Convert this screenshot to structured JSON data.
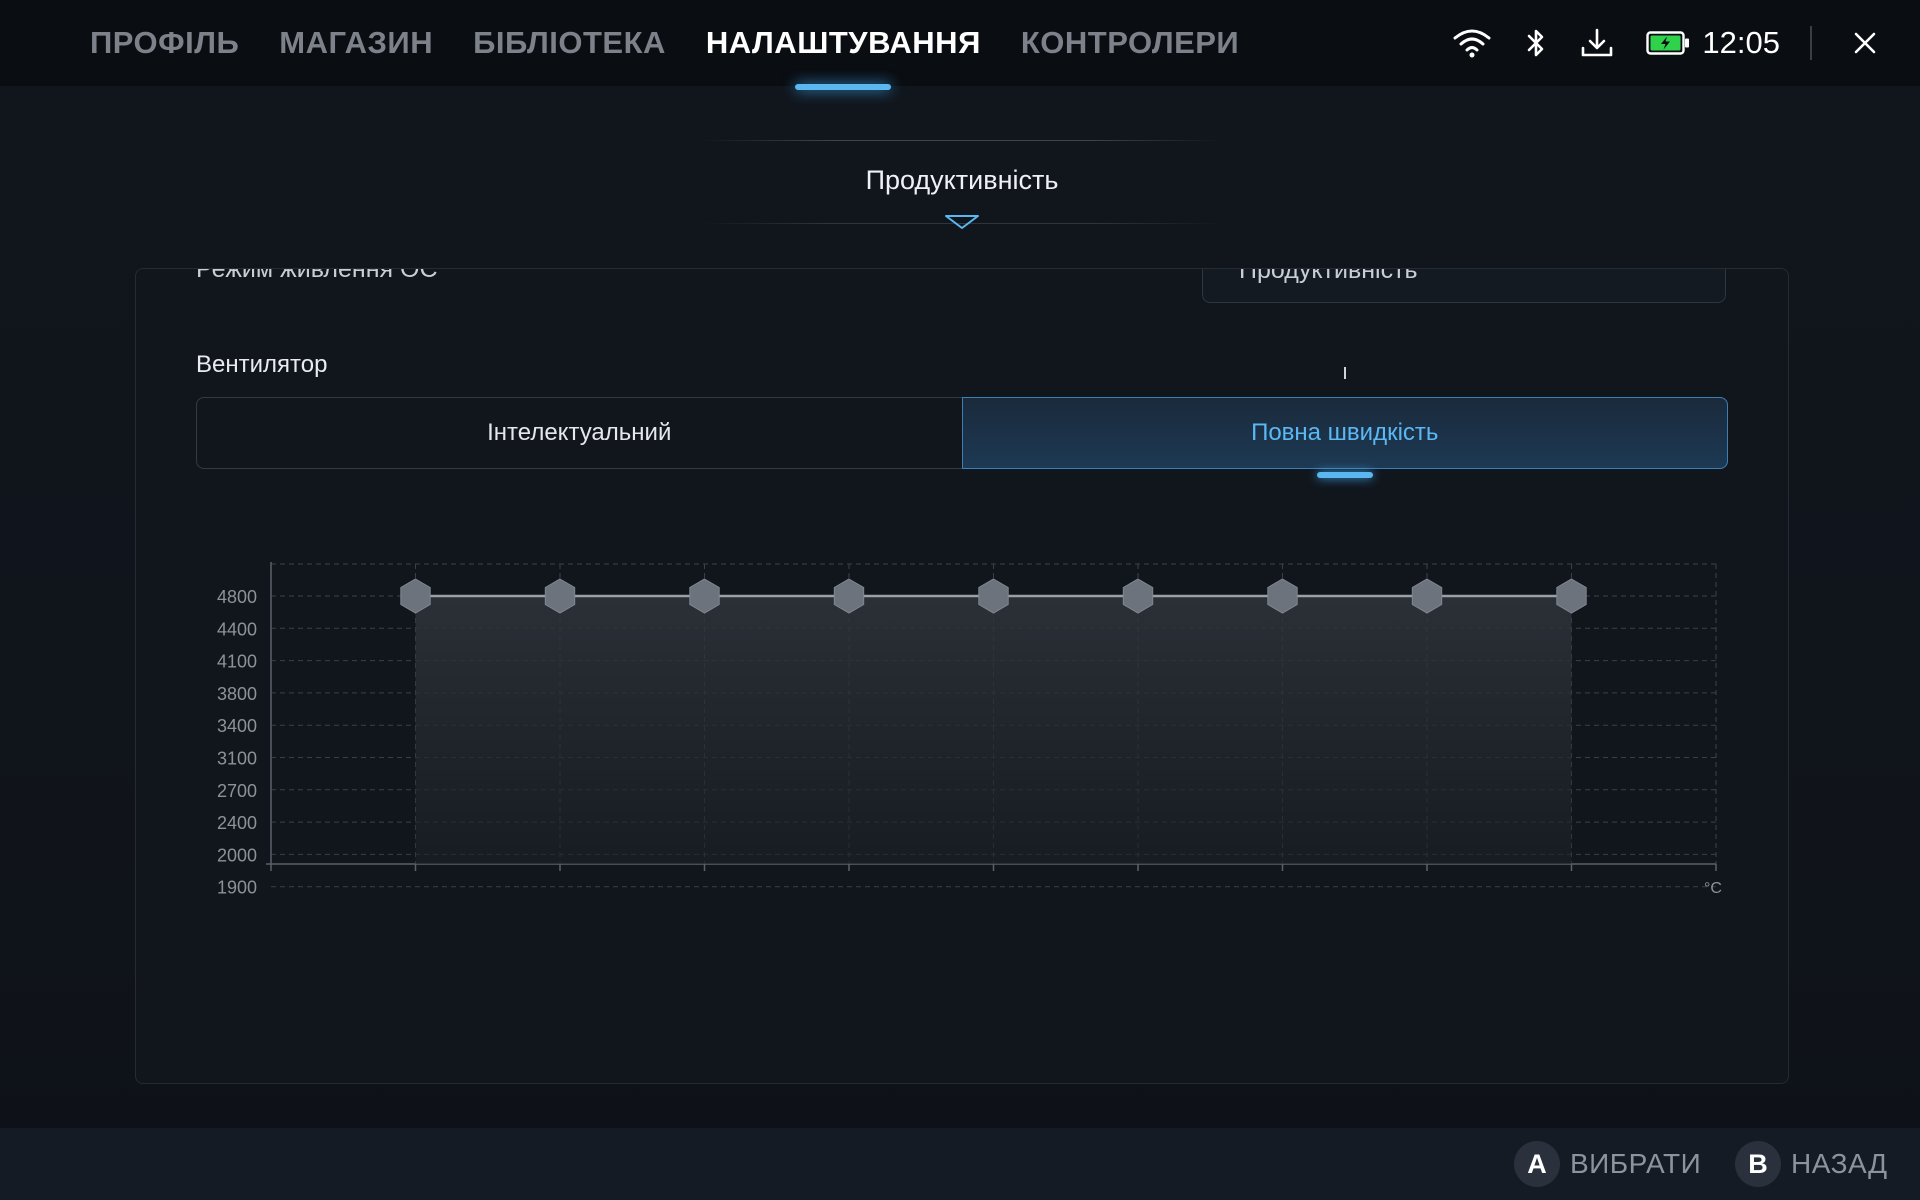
{
  "nav": {
    "tabs": [
      {
        "label": "ПРОФІЛЬ",
        "active": false
      },
      {
        "label": "МАГАЗИН",
        "active": false
      },
      {
        "label": "БІБЛІОТЕКА",
        "active": false
      },
      {
        "label": "НАЛАШТУВАННЯ",
        "active": true
      },
      {
        "label": "КОНТРОЛЕРИ",
        "active": false
      }
    ],
    "status": {
      "icons": [
        "wifi-icon",
        "bluetooth-icon",
        "download-icon",
        "battery-charging-icon"
      ],
      "time": "12:05"
    }
  },
  "section": {
    "title": "Продуктивність"
  },
  "panel": {
    "cut_row": {
      "label": "Режим живлення ОС",
      "value": "Продуктивність"
    },
    "fan": {
      "label": "Вентилятор",
      "modes": [
        "Інтелектуальний",
        "Повна швидкість"
      ],
      "selected_mode": "Повна швидкість"
    }
  },
  "chart_data": {
    "type": "line",
    "y_ticks": [
      "4800",
      "4400",
      "4100",
      "3800",
      "3400",
      "3100",
      "2700",
      "2400",
      "2000",
      "1900"
    ],
    "x_unit": "°C",
    "x_points": 9,
    "series": [
      {
        "values": [
          4800,
          4800,
          4800,
          4800,
          4800,
          4800,
          4800,
          4800,
          4800
        ]
      }
    ],
    "grid": true,
    "area_fill": true,
    "colors": {
      "line": "#9aa0a8",
      "marker": "#6c737d",
      "area": "#2a2f36",
      "grid": "#3a404a",
      "axis": "#5a616b"
    }
  },
  "footer": {
    "hints": [
      {
        "key": "A",
        "label": "ВИБРАТИ"
      },
      {
        "key": "B",
        "label": "НАЗАД"
      }
    ]
  },
  "colors": {
    "accent": "#5ab7f0",
    "background": "#0f131a"
  }
}
